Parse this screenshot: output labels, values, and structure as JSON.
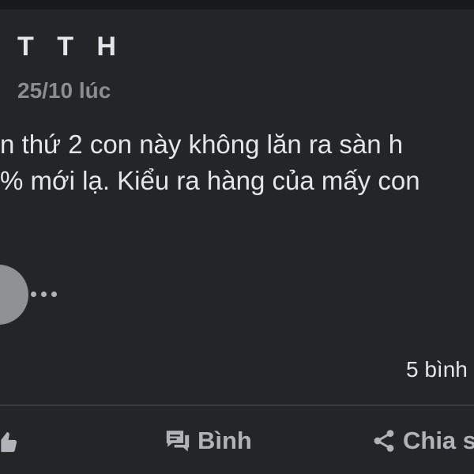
{
  "post": {
    "author": "T T H",
    "time": "25/10 lúc",
    "text_lines": [
      "n thứ 2 con này không lăn ra sàn h",
      "% mới lạ. Kiểu ra hàng của mấy con"
    ]
  },
  "stats": {
    "comments": "5 bình"
  },
  "actions": {
    "like_icon": "like-icon",
    "comment_label": "Bình",
    "comment_icon": "comment-icon",
    "share_label": "Chia s",
    "share_icon": "share-icon"
  },
  "colors": {
    "background": "#242526",
    "text": "#e4e6eb",
    "muted": "#8a8d91",
    "icon": "#b0b3b8",
    "divider": "#3a3b3c"
  }
}
